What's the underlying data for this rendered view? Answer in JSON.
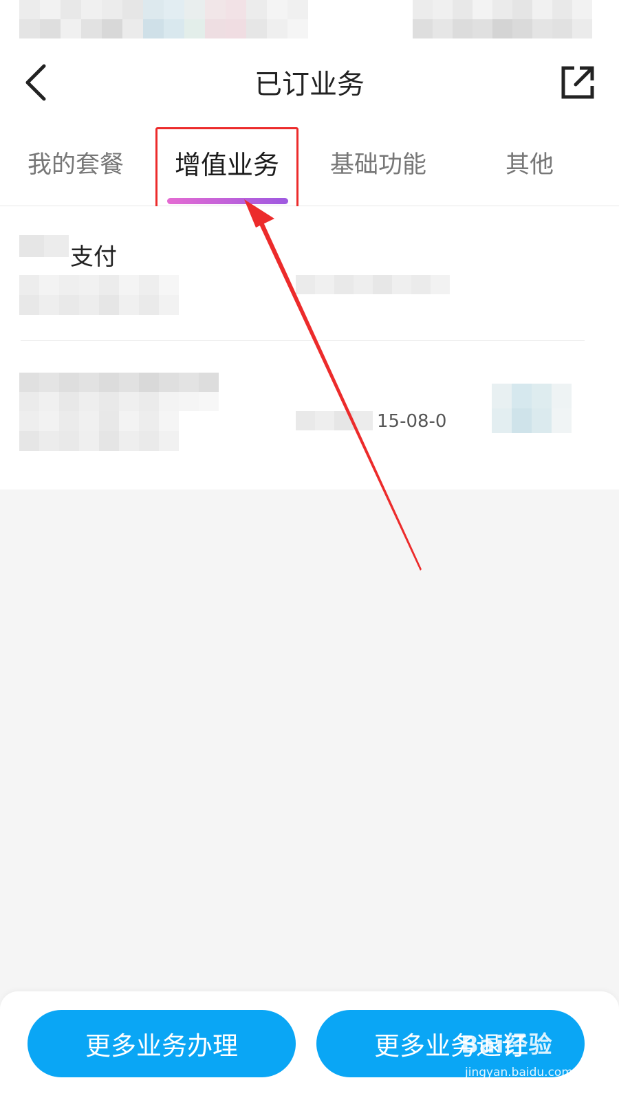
{
  "header": {
    "title": "已订业务",
    "back_icon": "chevron-left-icon",
    "share_icon": "share-icon"
  },
  "tabs": [
    {
      "label": "我的套餐",
      "active": false
    },
    {
      "label": "增值业务",
      "active": true
    },
    {
      "label": "基础功能",
      "active": false
    },
    {
      "label": "其他",
      "active": false
    }
  ],
  "items": [
    {
      "title": "支付",
      "date": ""
    },
    {
      "title": "",
      "date": "15-08-0"
    }
  ],
  "footer": {
    "left_button": "更多业务办理",
    "right_button": "更多业务退订"
  },
  "watermark": {
    "main": "Bai经验",
    "sub": "jingyan.baidu.com"
  },
  "colors": {
    "accent": "#0aa6f5",
    "tab_underline_start": "#e46bd2",
    "tab_underline_end": "#9e59e0",
    "annotation": "#ec2b2b",
    "background": "#f5f5f5"
  }
}
